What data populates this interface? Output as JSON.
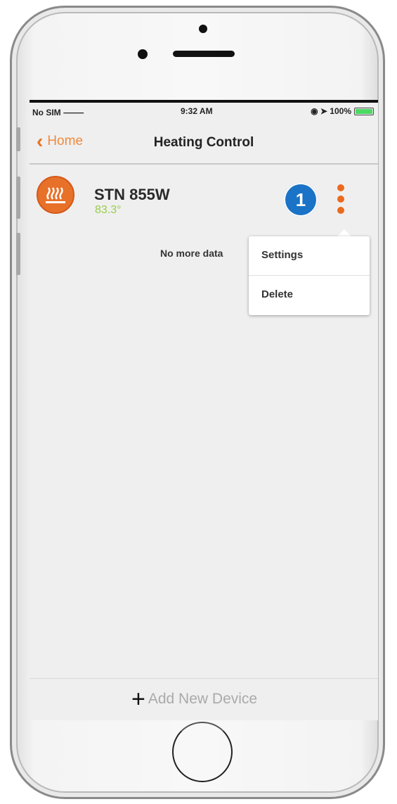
{
  "status_bar": {
    "carrier": "No SIM ⸻",
    "time": "9:32 AM",
    "battery_text": "◉ ➤ 100%"
  },
  "nav": {
    "back_label": "Home",
    "title": "Heating Control"
  },
  "device": {
    "name": "STN 855W",
    "temperature": "83.3°",
    "icon": "heater-icon"
  },
  "step_badge": "1",
  "empty_text": "No more data",
  "menu": {
    "items": [
      {
        "label": "Settings"
      },
      {
        "label": "Delete"
      }
    ]
  },
  "footer": {
    "add_label": "Add New Device"
  },
  "colors": {
    "accent": "#e8711f",
    "temp": "#9acd4a",
    "badge": "#1a73c6"
  }
}
